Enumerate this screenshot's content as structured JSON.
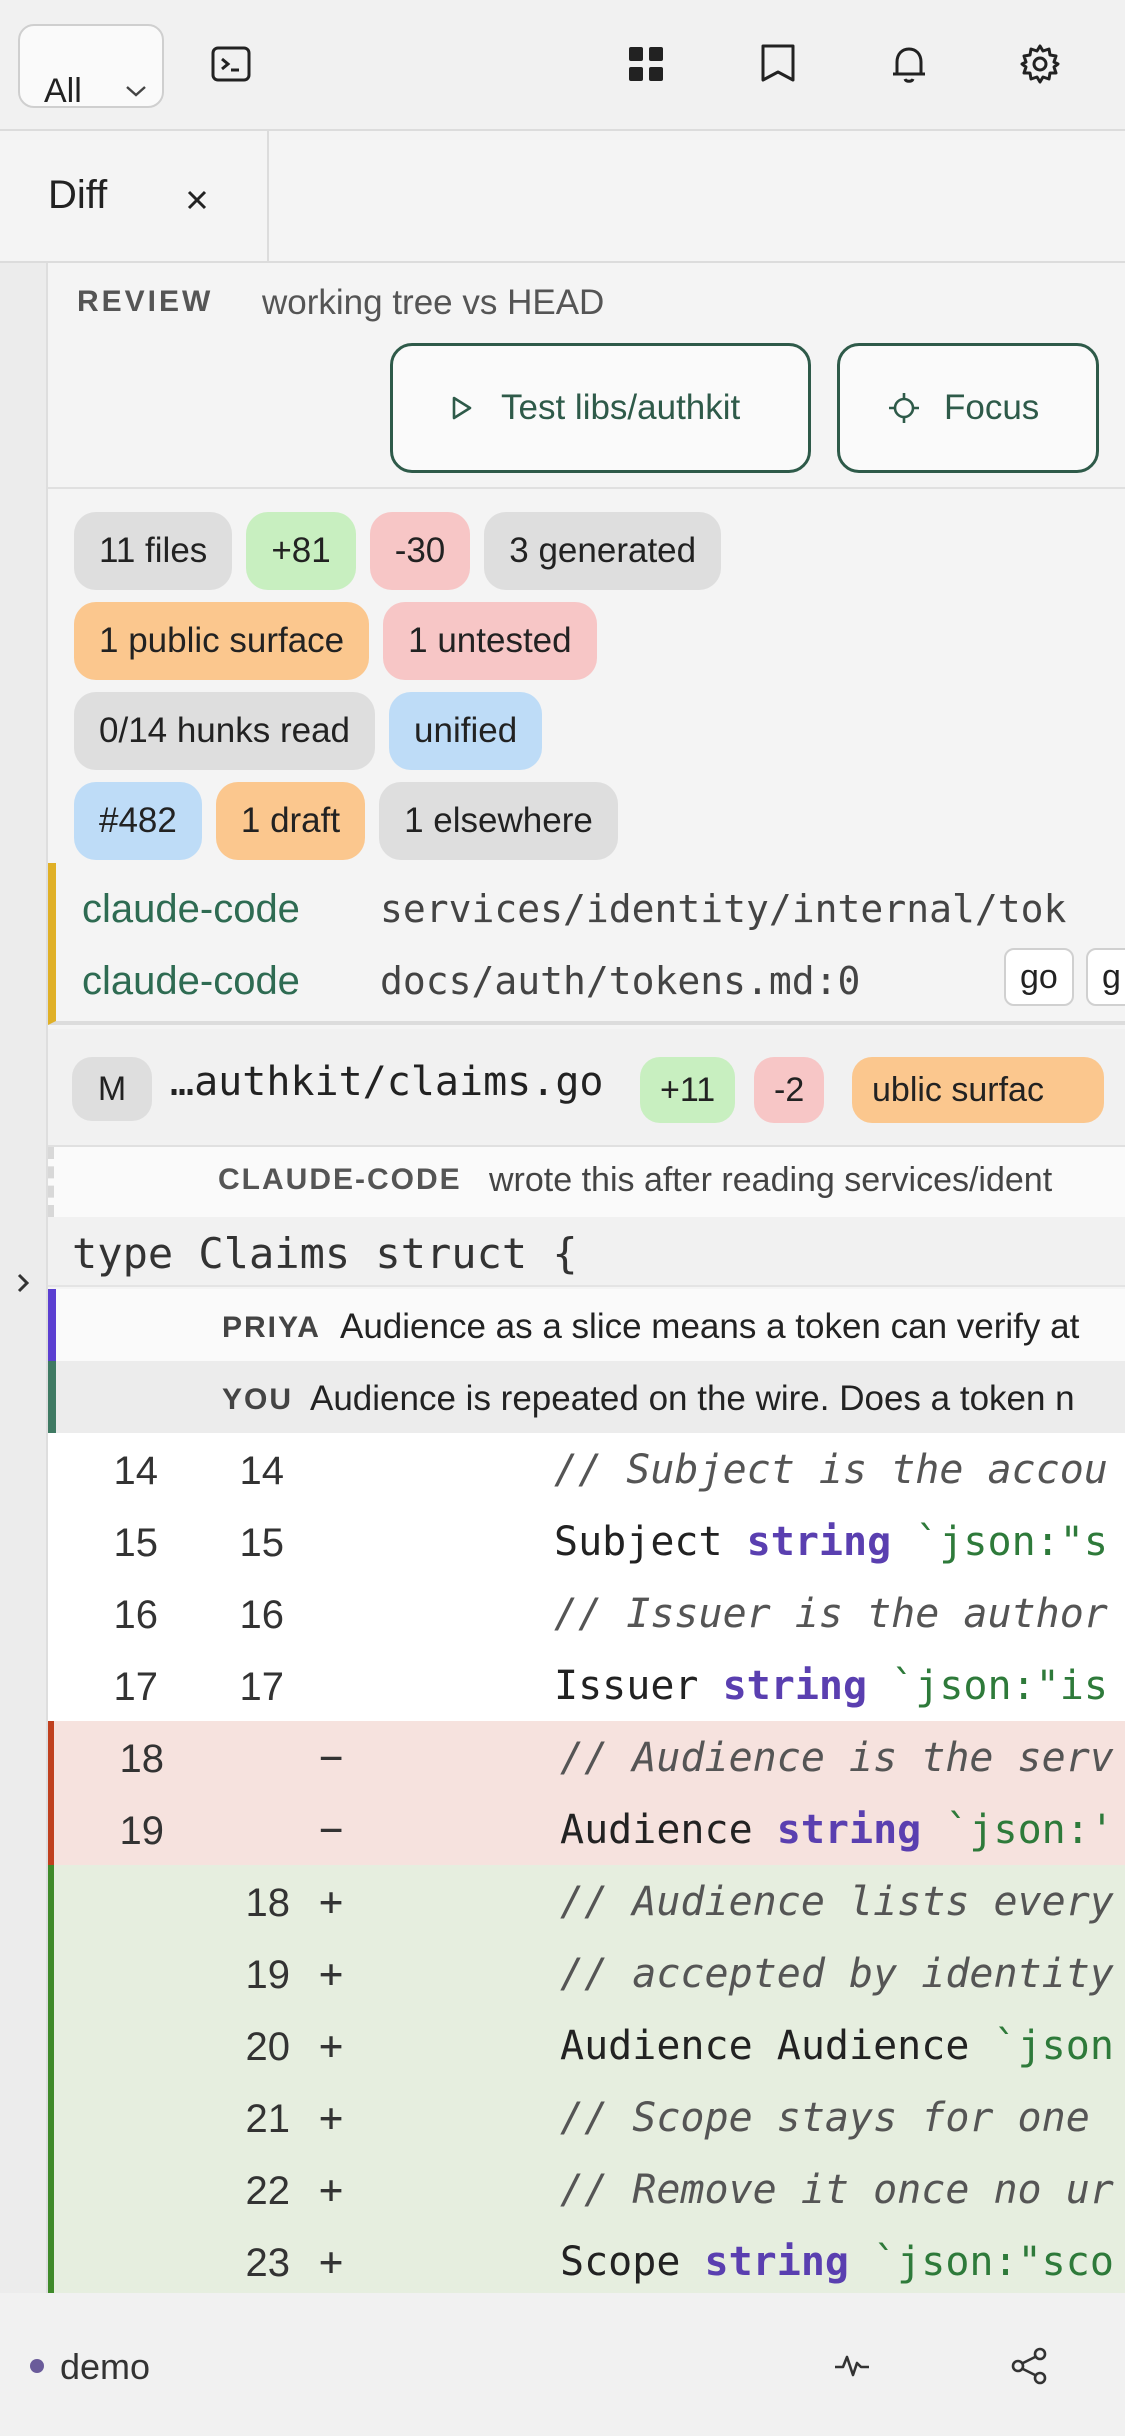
{
  "toolbar": {
    "scope_value": "All",
    "icons": [
      "terminal-icon",
      "grid-icon",
      "bookmark-icon",
      "bell-icon",
      "gear-icon"
    ]
  },
  "tabs": [
    {
      "label": "Diff",
      "close_icon": "close-icon"
    }
  ],
  "review": {
    "kicker": "REVIEW",
    "description": "working tree vs HEAD",
    "test_button": "Test libs/authkit",
    "focus_button": "Focus"
  },
  "chips": {
    "files": "11 files",
    "added": "+81",
    "removed": "-30",
    "generated": "3 generated",
    "public_surface": "1 public surface",
    "untested": "1 untested",
    "hunks_read": "0/14 hunks read",
    "view_mode": "unified",
    "pr": "#482",
    "draft": "1 draft",
    "elsewhere": "1 elsewhere"
  },
  "sessions": [
    {
      "agent": "claude-code",
      "path": "services/identity/internal/tok"
    },
    {
      "agent": "claude-code",
      "path": "docs/auth/tokens.md:0",
      "go_label": "go",
      "next_label": "g"
    }
  ],
  "file": {
    "status": "M",
    "name": "…authkit/claims.go",
    "added": "+11",
    "removed": "-2",
    "badge": "ublic surfac"
  },
  "agent_note": {
    "author": "CLAUDE-CODE",
    "text": "wrote this after reading services/ident"
  },
  "context_header": "type Claims struct {",
  "comments": [
    {
      "author": "PRIYA",
      "text": "Audience as a slice means a token can verify at"
    },
    {
      "author": "YOU",
      "text": "Audience is repeated on the wire. Does a token n"
    }
  ],
  "diff_lines": [
    {
      "kind": "ctx",
      "old": "14",
      "new": "14",
      "mark": "",
      "segments": [
        {
          "t": "// Subject is the accou",
          "c": "cm"
        }
      ]
    },
    {
      "kind": "ctx",
      "old": "15",
      "new": "15",
      "mark": "",
      "segments": [
        {
          "t": "Subject ",
          "c": ""
        },
        {
          "t": "string",
          "c": "kw"
        },
        {
          "t": " `json:\"s",
          "c": "str"
        }
      ]
    },
    {
      "kind": "ctx",
      "old": "16",
      "new": "16",
      "mark": "",
      "segments": [
        {
          "t": "// Issuer is the author",
          "c": "cm"
        }
      ]
    },
    {
      "kind": "ctx",
      "old": "17",
      "new": "17",
      "mark": "",
      "segments": [
        {
          "t": "Issuer ",
          "c": ""
        },
        {
          "t": "string",
          "c": "kw"
        },
        {
          "t": " `json:\"is",
          "c": "str"
        }
      ]
    },
    {
      "kind": "del",
      "old": "18",
      "new": "",
      "mark": "−",
      "segments": [
        {
          "t": "// Audience is the serv",
          "c": "cm"
        }
      ]
    },
    {
      "kind": "del",
      "old": "19",
      "new": "",
      "mark": "−",
      "segments": [
        {
          "t": "Audience ",
          "c": ""
        },
        {
          "t": "string",
          "c": "kw"
        },
        {
          "t": " `json:'",
          "c": "str"
        }
      ]
    },
    {
      "kind": "add",
      "old": "",
      "new": "18",
      "mark": "+",
      "segments": [
        {
          "t": "// Audience lists every",
          "c": "cm"
        }
      ]
    },
    {
      "kind": "add",
      "old": "",
      "new": "19",
      "mark": "+",
      "segments": [
        {
          "t": "// accepted by identity",
          "c": "cm"
        }
      ]
    },
    {
      "kind": "add",
      "old": "",
      "new": "20",
      "mark": "+",
      "segments": [
        {
          "t": "Audience Audience ",
          "c": ""
        },
        {
          "t": "`json",
          "c": "str"
        }
      ]
    },
    {
      "kind": "add",
      "old": "",
      "new": "21",
      "mark": "+",
      "segments": [
        {
          "t": "// Scope stays for one",
          "c": "cm"
        }
      ]
    },
    {
      "kind": "add",
      "old": "",
      "new": "22",
      "mark": "+",
      "segments": [
        {
          "t": "// Remove it once no ur",
          "c": "cm"
        }
      ]
    },
    {
      "kind": "add",
      "old": "",
      "new": "23",
      "mark": "+",
      "segments": [
        {
          "t": "Scope ",
          "c": ""
        },
        {
          "t": "string",
          "c": "kw"
        },
        {
          "t": " `json:\"sco",
          "c": "str"
        }
      ]
    }
  ],
  "statusbar": {
    "project": "demo",
    "icons": [
      "activity-icon",
      "share-icon"
    ]
  },
  "colors": {
    "accent": "#2e5a49",
    "session_bar": "#e0b026",
    "priya_bar": "#5b3fd1",
    "you_bar": "#3f7a63",
    "deleted_bar": "#c0401e",
    "added_bar": "#3f8a2a"
  }
}
